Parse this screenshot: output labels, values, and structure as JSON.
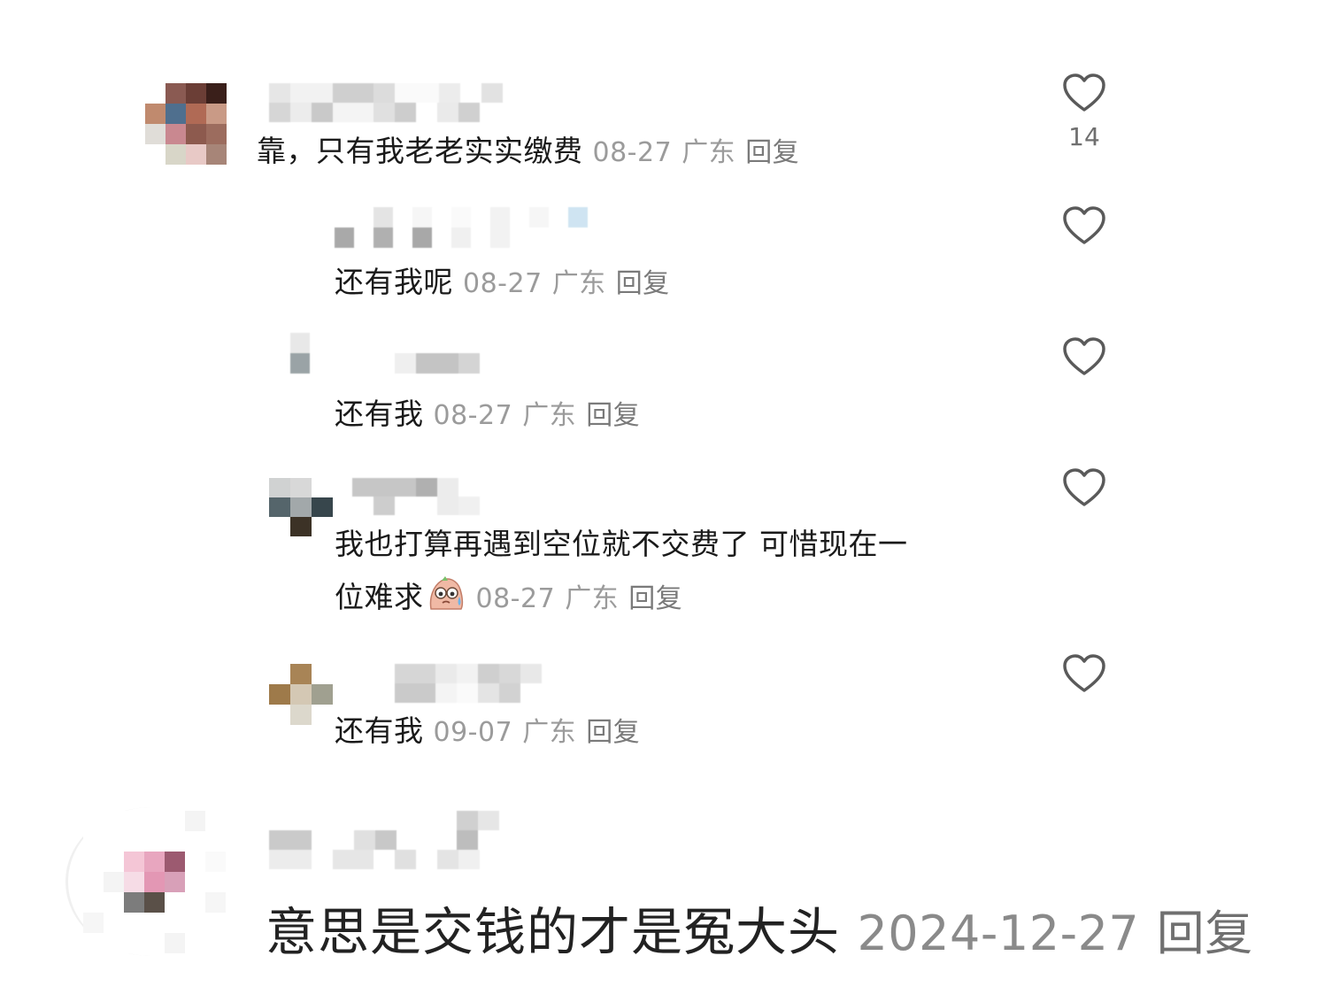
{
  "like_icon": "heart-outline-icon",
  "comments": [
    {
      "text": "靠，只有我老老实实缴费",
      "date": "08-27",
      "location": "广东",
      "reply_label": "回复",
      "like_count": "14"
    },
    {
      "text": "还有我呢",
      "date": "08-27",
      "location": "广东",
      "reply_label": "回复"
    },
    {
      "text": "还有我",
      "date": "08-27",
      "location": "广东",
      "reply_label": "回复"
    },
    {
      "text_line1": "我也打算再遇到空位就不交费了 可惜现在一",
      "text_line2": "位难求",
      "emoji": "sweat-face-emoji",
      "date": "08-27",
      "location": "广东",
      "reply_label": "回复"
    },
    {
      "text": "还有我",
      "date": "09-07",
      "location": "广东",
      "reply_label": "回复"
    },
    {
      "text": "意思是交钱的才是冤大头",
      "date": "2024-12-27",
      "reply_label": "回复"
    }
  ]
}
